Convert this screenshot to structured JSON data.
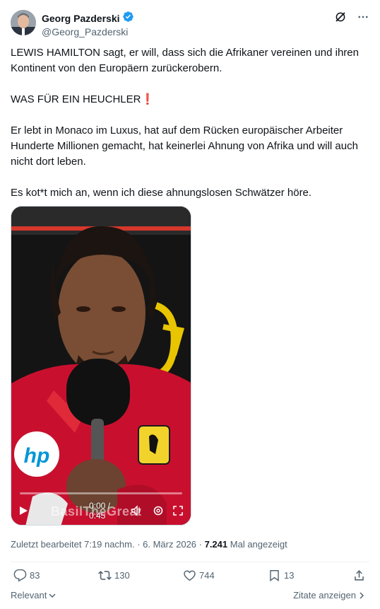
{
  "author": {
    "name": "Georg Pazderski",
    "handle": "@Georg_Pazderski",
    "verified_color": "#1d9bf0"
  },
  "post": {
    "paragraphs": [
      "LEWIS HAMILTON sagt, er will, dass sich die Afrikaner vereinen und ihren Kontinent von den Europäern zurückerobern.",
      "WAS FÜR EIN HEUCHLER❗",
      "Er lebt in Monaco im Luxus, hat auf dem Rücken europäischer Arbeiter Hunderte Millionen gemacht, hat keinerlei Ahnung von Afrika und will auch nicht dort leben.",
      "Es kot*t mich an, wenn ich diese ahnungslosen Schwätzer höre."
    ]
  },
  "video": {
    "time": "0:00 / 0:45",
    "watermark": "BasilTheGreat",
    "progress": 0.0,
    "accent": "#c8102e"
  },
  "meta": {
    "edited": "Zuletzt bearbeitet 7:19 nachm. · 6. März 2026 ·",
    "views": "7.241",
    "views_label": "Mal angezeigt"
  },
  "actions": {
    "replies": "83",
    "reposts": "130",
    "likes": "744",
    "bookmarks": "13"
  },
  "footer": {
    "sort_label": "Relevant",
    "quotes_label": "Zitate anzeigen"
  },
  "icons": {
    "verified": "verified-badge-icon",
    "grok": "grok-icon",
    "more": "more-icon"
  }
}
